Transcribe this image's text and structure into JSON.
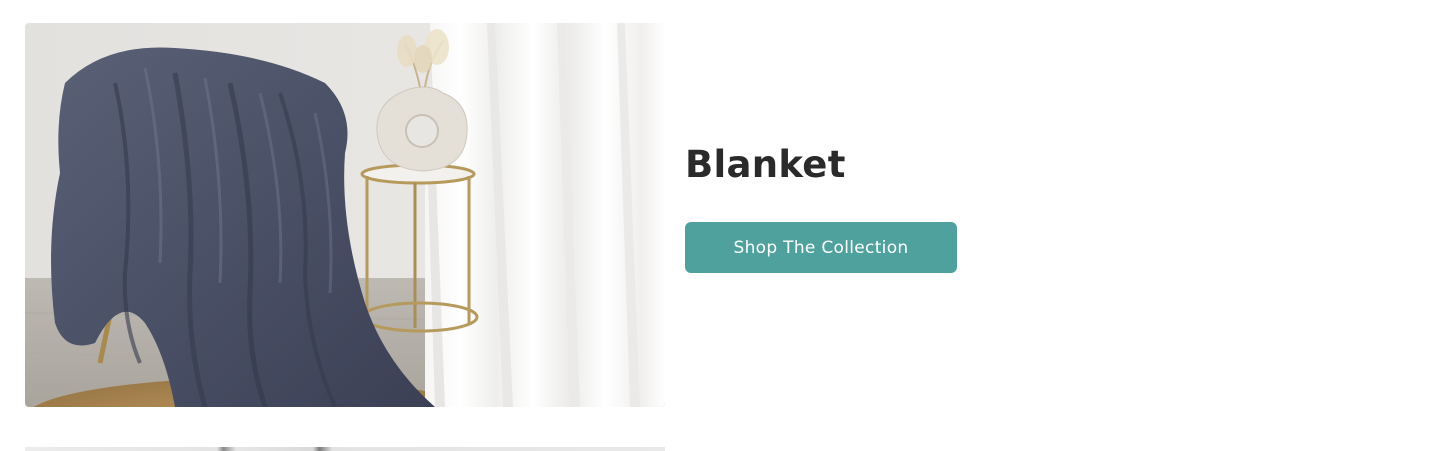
{
  "collection": {
    "title": "Blanket",
    "button_label": "Shop The Collection",
    "image_subject": "blanket-on-chair-photo"
  },
  "colors": {
    "button_background": "#4ea19c",
    "button_text": "#ffffff",
    "title_text": "#2a2a2a",
    "page_background": "#ffffff"
  }
}
